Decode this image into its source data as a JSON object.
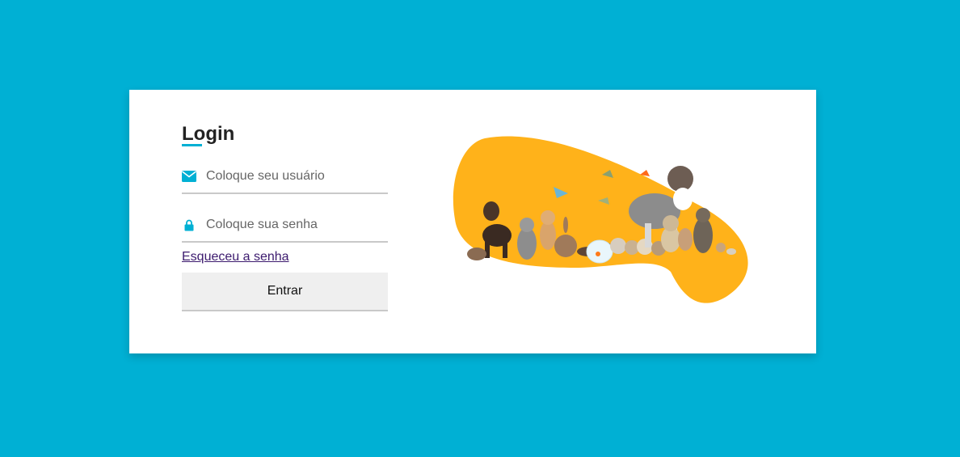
{
  "login": {
    "title": "Login",
    "username_placeholder": "Coloque seu usuário",
    "password_placeholder": "Coloque sua senha",
    "forgot_link": "Esqueceu a senha",
    "submit_label": "Entrar"
  },
  "icons": {
    "username": "envelope-icon",
    "password": "lock-icon"
  },
  "colors": {
    "background": "#00b0d4",
    "accent": "#00b0d4",
    "illustration_blob": "#ffb21a",
    "link": "#3c1a6e"
  },
  "illustration": {
    "alt": "pets-group-illustration"
  }
}
